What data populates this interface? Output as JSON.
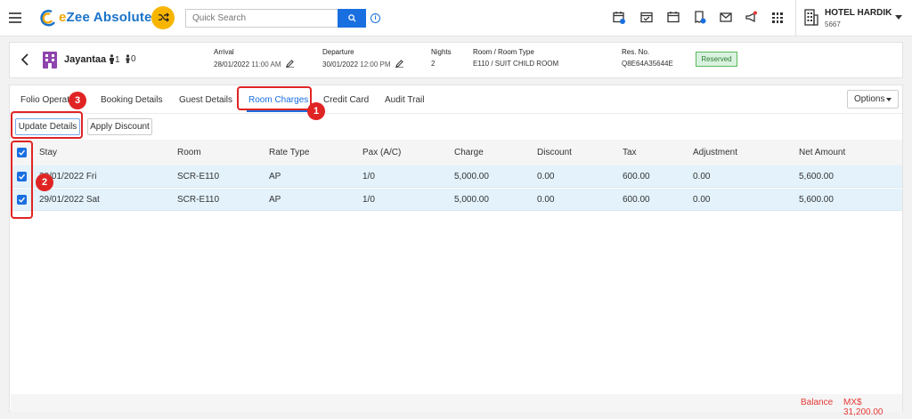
{
  "app": {
    "name_e": "e",
    "name_rest": "Zee Absolute"
  },
  "topbar": {
    "search_placeholder": "Quick Search",
    "hotel_name": "HOTEL HARDIK",
    "hotel_code": "5667"
  },
  "reservation": {
    "guest_name": "Jayantaa",
    "adults": "1",
    "children": "0",
    "arrival_label": "Arrival",
    "arrival_date": "28/01/2022",
    "arrival_time": "11:00 AM",
    "departure_label": "Departure",
    "departure_date": "30/01/2022",
    "departure_time": "12:00 PM",
    "nights_label": "Nights",
    "nights": "2",
    "room_label": "Room / Room Type",
    "room_value": "E110 / SUIT CHILD ROOM",
    "resno_label": "Res. No.",
    "resno_value": "Q8E64A35644E",
    "status": "Reserved"
  },
  "tabs": [
    {
      "label": "Folio Operations"
    },
    {
      "label": "Booking Details"
    },
    {
      "label": "Guest Details"
    },
    {
      "label": "Room Charges"
    },
    {
      "label": "Credit Card"
    },
    {
      "label": "Audit Trail"
    }
  ],
  "options_label": "Options",
  "actions": {
    "update_details": "Update Details",
    "apply_discount": "Apply Discount"
  },
  "table": {
    "columns": [
      "Stay",
      "Room",
      "Rate Type",
      "Pax (A/C)",
      "Charge",
      "Discount",
      "Tax",
      "Adjustment",
      "Net Amount"
    ],
    "rows": [
      {
        "stay": "28/01/2022 Fri",
        "room": "SCR-E110",
        "rate": "AP",
        "pax": "1/0",
        "charge": "5,000.00",
        "discount": "0.00",
        "tax": "600.00",
        "adjustment": "0.00",
        "net": "5,600.00"
      },
      {
        "stay": "29/01/2022 Sat",
        "room": "SCR-E110",
        "rate": "AP",
        "pax": "1/0",
        "charge": "5,000.00",
        "discount": "0.00",
        "tax": "600.00",
        "adjustment": "0.00",
        "net": "5,600.00"
      }
    ]
  },
  "balance": {
    "label": "Balance",
    "value": "MX$ 31,200.00"
  },
  "annotations": {
    "step1": "1",
    "step2": "2",
    "step3": "3"
  },
  "colors": {
    "accent": "#1a6fe0",
    "callout": "#e02424",
    "selected_row": "#e3f2fb",
    "reserved_bg": "#d9f2df",
    "balance": "#e53935"
  }
}
